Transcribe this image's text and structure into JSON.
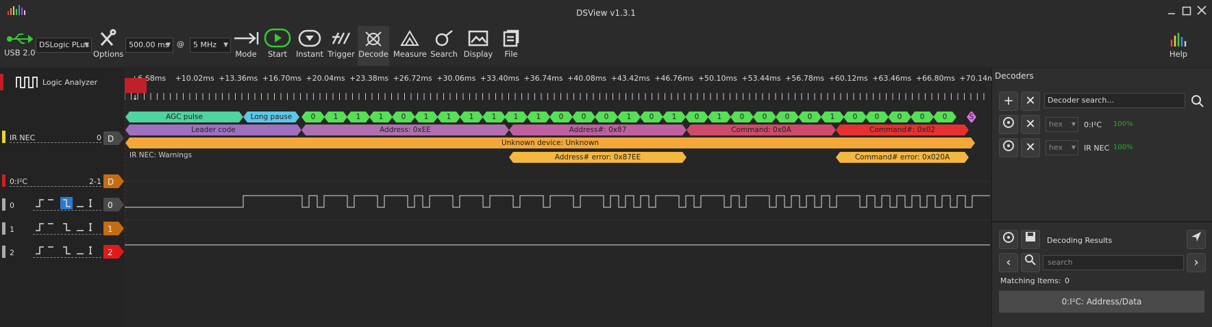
{
  "app": {
    "title": "DSView v1.3.1"
  },
  "toolbar": {
    "usb_label": "USB 2.0",
    "device": "DSLogic PLus",
    "options_label": "Options",
    "duration": "500.00 ms",
    "at": "@",
    "rate": "5 MHz",
    "mode_label": "Mode",
    "start_label": "Start",
    "instant_label": "Instant",
    "trigger_label": "Trigger",
    "decode_label": "Decode",
    "measure_label": "Measure",
    "search_label": "Search",
    "display_label": "Display",
    "file_label": "File",
    "help_label": "Help"
  },
  "left": {
    "logic_analyzer": "Logic Analyzer",
    "ir_nec": "IR NEC",
    "ir_nec_idx": "0",
    "ir_nec_tag": "D",
    "i2c": "0:I²C",
    "i2c_idx": "2-1",
    "i2c_tag": "D",
    "ch0": "0",
    "ch1": "1",
    "ch2": "2",
    "ch0_tag": "0",
    "ch1_tag": "1",
    "ch2_tag": "2"
  },
  "ruler": {
    "ticks": [
      "+6.68ms",
      "+10.02ms",
      "+13.36ms",
      "+16.70ms",
      "+20.04ms",
      "+23.38ms",
      "+26.72ms",
      "+30.06ms",
      "+33.40ms",
      "+36.74ms",
      "+40.08ms",
      "+43.42ms",
      "+46.76ms",
      "+50.10ms",
      "+53.44ms",
      "+56.78ms",
      "+60.12ms",
      "+63.46ms",
      "+66.80ms",
      "+70.14m"
    ]
  },
  "decode": {
    "row1": [
      {
        "text": "AGC pulse",
        "color": "#4fd3a0"
      },
      {
        "text": "Long pause",
        "color": "#5bc8e8"
      },
      {
        "text": "0",
        "color": "#55e055"
      },
      {
        "text": "1",
        "color": "#55e055"
      },
      {
        "text": "1",
        "color": "#55e055"
      },
      {
        "text": "1",
        "color": "#55e055"
      },
      {
        "text": "0",
        "color": "#55e055"
      },
      {
        "text": "1",
        "color": "#55e055"
      },
      {
        "text": "1",
        "color": "#55e055"
      },
      {
        "text": "1",
        "color": "#55e055"
      },
      {
        "text": "1",
        "color": "#55e055"
      },
      {
        "text": "1",
        "color": "#55e055"
      },
      {
        "text": "1",
        "color": "#55e055"
      },
      {
        "text": "0",
        "color": "#55e055"
      },
      {
        "text": "0",
        "color": "#55e055"
      },
      {
        "text": "0",
        "color": "#55e055"
      },
      {
        "text": "1",
        "color": "#55e055"
      },
      {
        "text": "0",
        "color": "#55e055"
      },
      {
        "text": "1",
        "color": "#55e055"
      },
      {
        "text": "0",
        "color": "#55e055"
      },
      {
        "text": "1",
        "color": "#55e055"
      },
      {
        "text": "0",
        "color": "#55e055"
      },
      {
        "text": "0",
        "color": "#55e055"
      },
      {
        "text": "0",
        "color": "#55e055"
      },
      {
        "text": "0",
        "color": "#55e055"
      },
      {
        "text": "1",
        "color": "#55e055"
      },
      {
        "text": "0",
        "color": "#55e055"
      },
      {
        "text": "0",
        "color": "#55e055"
      },
      {
        "text": "0",
        "color": "#55e055"
      },
      {
        "text": "0",
        "color": "#55e055"
      },
      {
        "text": "0",
        "color": "#55e055"
      },
      {
        "text": "S",
        "color": "#e070e0"
      }
    ],
    "row2": [
      {
        "text": "Leader code",
        "color": "#a070c0"
      },
      {
        "text": "Address: 0xEE",
        "color": "#b070b0"
      },
      {
        "text": "Address#: 0x87",
        "color": "#c060a0"
      },
      {
        "text": "Command: 0x0A",
        "color": "#d04a6a"
      },
      {
        "text": "Command#: 0x02",
        "color": "#e83030"
      }
    ],
    "row3": {
      "text": "Unknown device: Unknown",
      "color": "#f4a83a"
    },
    "warnings_label": "IR NEC: Warnings",
    "row4": [
      {
        "text": "Address# error: 0x87EE",
        "color": "#f4b840"
      },
      {
        "text": "Command# error: 0x020A",
        "color": "#f4b840"
      }
    ]
  },
  "decoders": {
    "title": "Decoders",
    "search_placeholder": "Decoder search...",
    "items": [
      {
        "name": "0:I²C",
        "format": "hex",
        "percent": "100%"
      },
      {
        "name": "IR NEC",
        "format": "hex",
        "percent": "100%"
      }
    ],
    "results_title": "Decoding Results",
    "results_search_placeholder": "search",
    "matching_label": "Matching Items:",
    "matching_count": "0",
    "result_row": "0:I²C: Address/Data"
  }
}
